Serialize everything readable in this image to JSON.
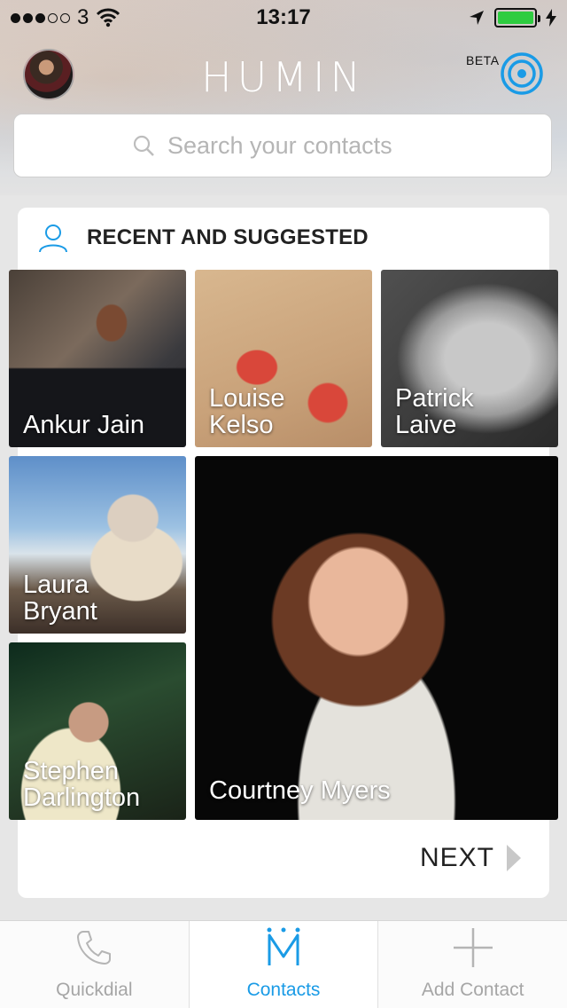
{
  "status_bar": {
    "carrier": "3",
    "time": "13:17"
  },
  "header": {
    "logo": "HUMIN",
    "beta_label": "BETA"
  },
  "search": {
    "placeholder": "Search your contacts"
  },
  "recent": {
    "title": "RECENT AND SUGGESTED",
    "contacts": [
      {
        "name_line1": "Ankur Jain",
        "name_line2": ""
      },
      {
        "name_line1": "Louise",
        "name_line2": "Kelso"
      },
      {
        "name_line1": "Patrick",
        "name_line2": "Laive"
      },
      {
        "name_line1": "Laura",
        "name_line2": "Bryant"
      },
      {
        "name_line1": "Stephen",
        "name_line2": "Darlington"
      },
      {
        "name_line1": "Courtney Myers",
        "name_line2": ""
      }
    ],
    "next_label": "NEXT"
  },
  "tabs": [
    {
      "label": "Quickdial",
      "icon": "phone-icon"
    },
    {
      "label": "Contacts",
      "icon": "humin-m-icon"
    },
    {
      "label": "Add Contact",
      "icon": "plus-icon"
    }
  ],
  "colors": {
    "accent": "#1a9be6",
    "battery": "#2ecc40"
  }
}
